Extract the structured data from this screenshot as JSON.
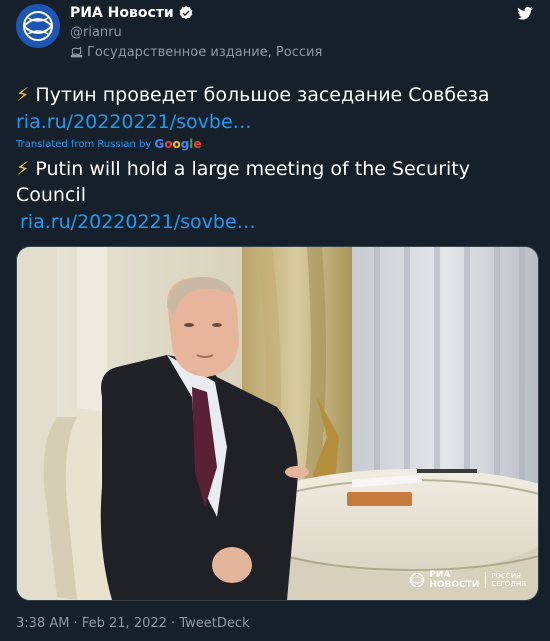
{
  "account": {
    "name": "РИА Новости",
    "handle": "@rianru",
    "label": "Государственное издание, Россия"
  },
  "tweet": {
    "original_text": "Путин проведет большое заседание Совбеза",
    "original_link": "ria.ru/20220221/sovbe…",
    "translated_from": "Translated from Russian by",
    "google": [
      "G",
      "o",
      "o",
      "g",
      "l",
      "e"
    ],
    "translated_line1": "Putin will hold a large meeting of the Security",
    "translated_line2": "Council",
    "translated_link": "ria.ru/20220221/sovbe…"
  },
  "image": {
    "watermark_title_1": "РИА",
    "watermark_title_2": "НОВОСТИ",
    "watermark_sub_1": "РОССИЯ",
    "watermark_sub_2": "СЕГОДНЯ"
  },
  "meta": {
    "time": "3:38 AM",
    "date": "Feb 21, 2022",
    "source": "TweetDeck"
  },
  "colors": {
    "background": "#15202b",
    "link": "#1d9bf0",
    "secondary_text": "#8b98a5",
    "bolt": "#f4c430"
  }
}
